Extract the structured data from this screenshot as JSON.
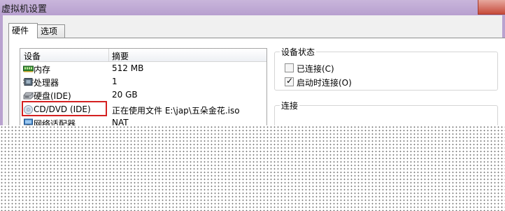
{
  "window": {
    "title": "虚拟机设置"
  },
  "tabs": [
    {
      "label": "硬件",
      "active": true
    },
    {
      "label": "选项",
      "active": false
    }
  ],
  "device_list": {
    "columns": [
      "设备",
      "摘要"
    ],
    "rows": [
      {
        "icon": "memory-icon",
        "name": "内存",
        "summary": "512 MB"
      },
      {
        "icon": "processor-icon",
        "name": "处理器",
        "summary": "1"
      },
      {
        "icon": "hard-disk-icon",
        "name": "硬盘(IDE)",
        "summary": "20 GB"
      },
      {
        "icon": "cd-dvd-icon",
        "name": "CD/DVD (IDE)",
        "summary": "正在使用文件 E:\\jap\\五朵金花.iso",
        "highlighted": true
      },
      {
        "icon": "network-adapter-icon",
        "name": "网络适配器",
        "summary": "NAT"
      }
    ]
  },
  "device_status": {
    "legend": "设备状态",
    "connected": {
      "label": "已连接(C)",
      "checked": false
    },
    "connect_at_power_on": {
      "label": "启动时连接(O)",
      "checked": true
    }
  },
  "connection": {
    "legend": "连接"
  },
  "colors": {
    "highlight_border": "#d42020",
    "title_bar": "#b79fcf"
  }
}
